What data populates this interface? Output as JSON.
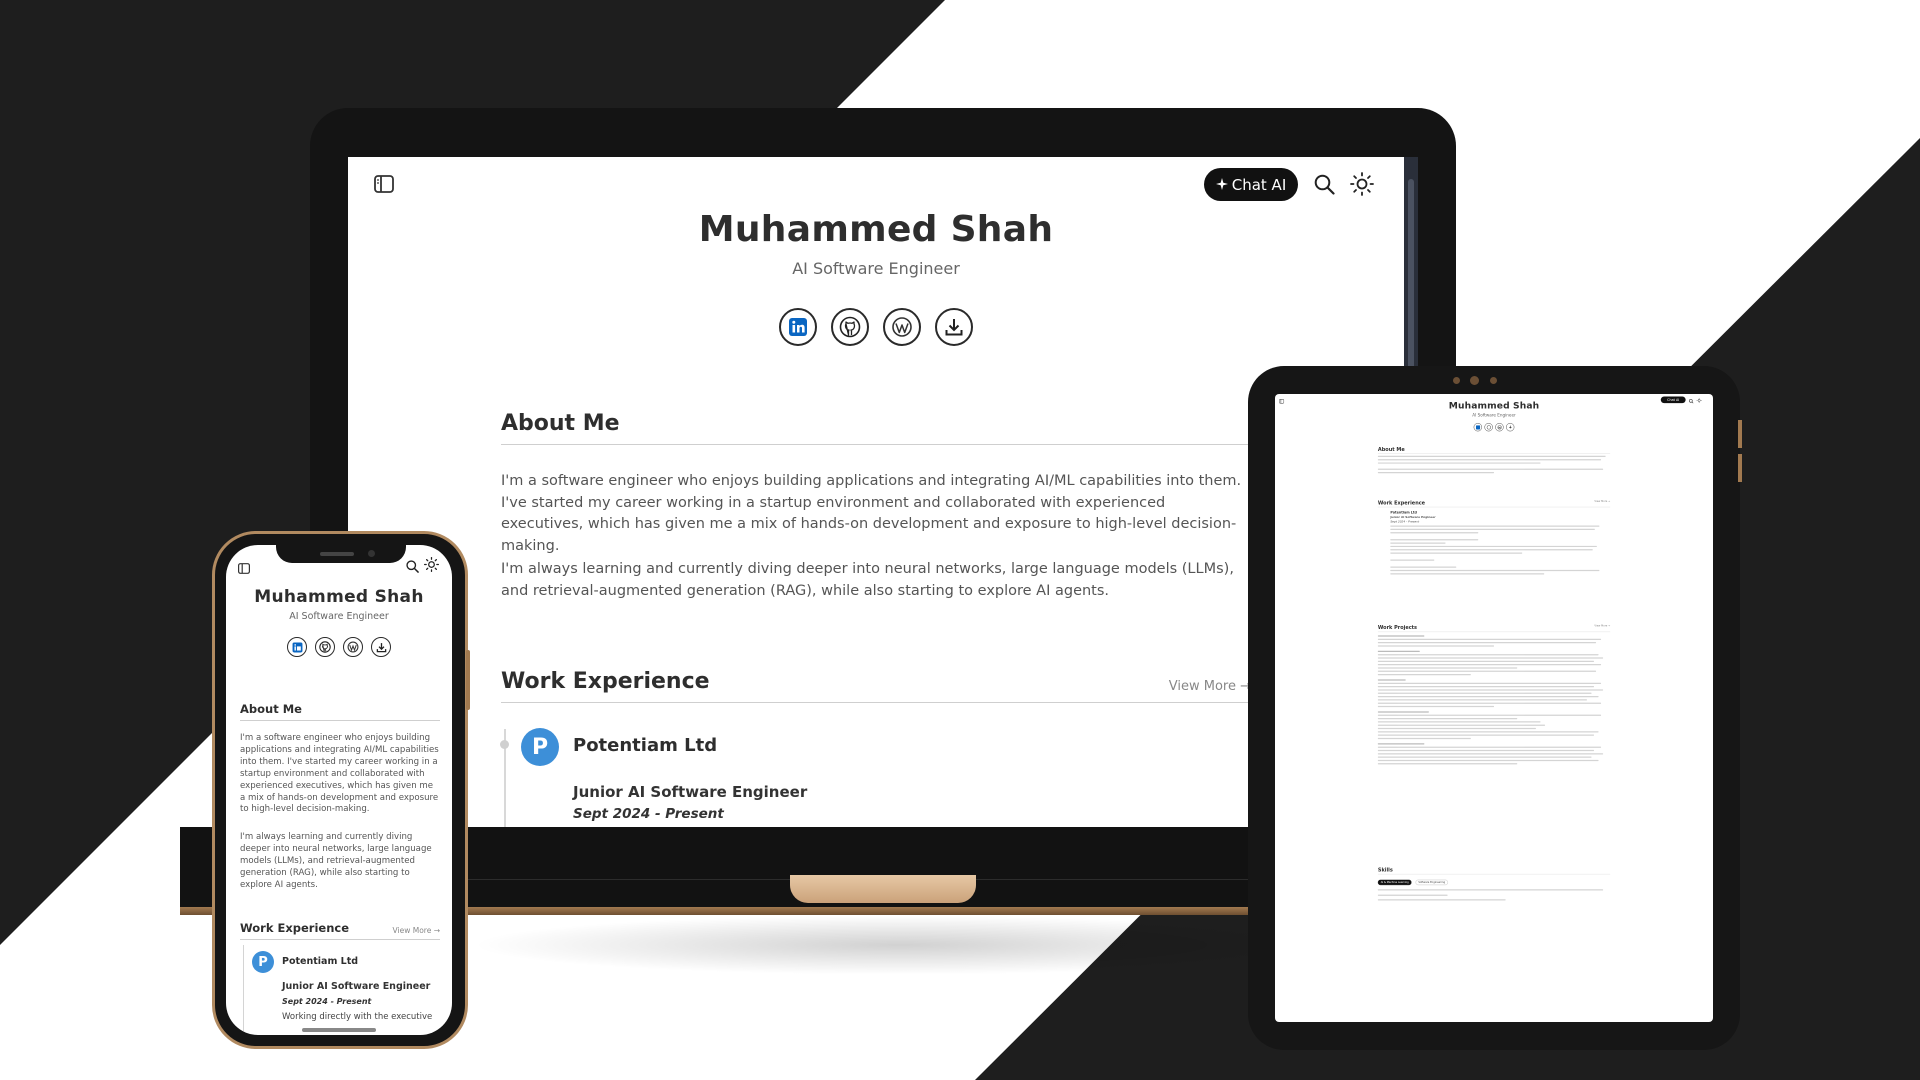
{
  "profile": {
    "name": "Muhammed Shah",
    "role": "AI Software Engineer"
  },
  "toolbar": {
    "chat_label": "Chat AI",
    "icons": [
      "sidebar-toggle-icon",
      "sparkle-icon",
      "search-icon",
      "sun-icon"
    ]
  },
  "social": [
    "linkedin-icon",
    "github-icon",
    "wordpress-icon",
    "download-icon"
  ],
  "about": {
    "title": "About Me",
    "paragraphs": [
      "I'm a software engineer who enjoys building applications and integrating AI/ML capabilities into them. I've started my career working in a startup environment and collaborated with experienced executives, which has given me a mix of hands-on development and exposure to high-level decision-making.",
      "I'm always learning and currently diving deeper into neural networks, large language models (LLMs), and retrieval-augmented generation (RAG), while also starting to explore AI agents."
    ]
  },
  "work": {
    "title": "Work Experience",
    "view_more": "View More →",
    "company": "Potentiam Ltd",
    "company_initial": "P",
    "job_title": "Junior AI Software Engineer",
    "dates": "Sept 2024 - Present",
    "desc_start": "Working directly with the executive"
  },
  "tablet": {
    "projects_title": "Work Projects",
    "skills_title": "Skills",
    "skills_tabs": [
      "AI & Machine Learning",
      "Software Engineering"
    ]
  },
  "colors": {
    "background_dark": "#1e1e1e",
    "accent_gold": "#a27a50",
    "company_logo": "#3d8fd8"
  }
}
